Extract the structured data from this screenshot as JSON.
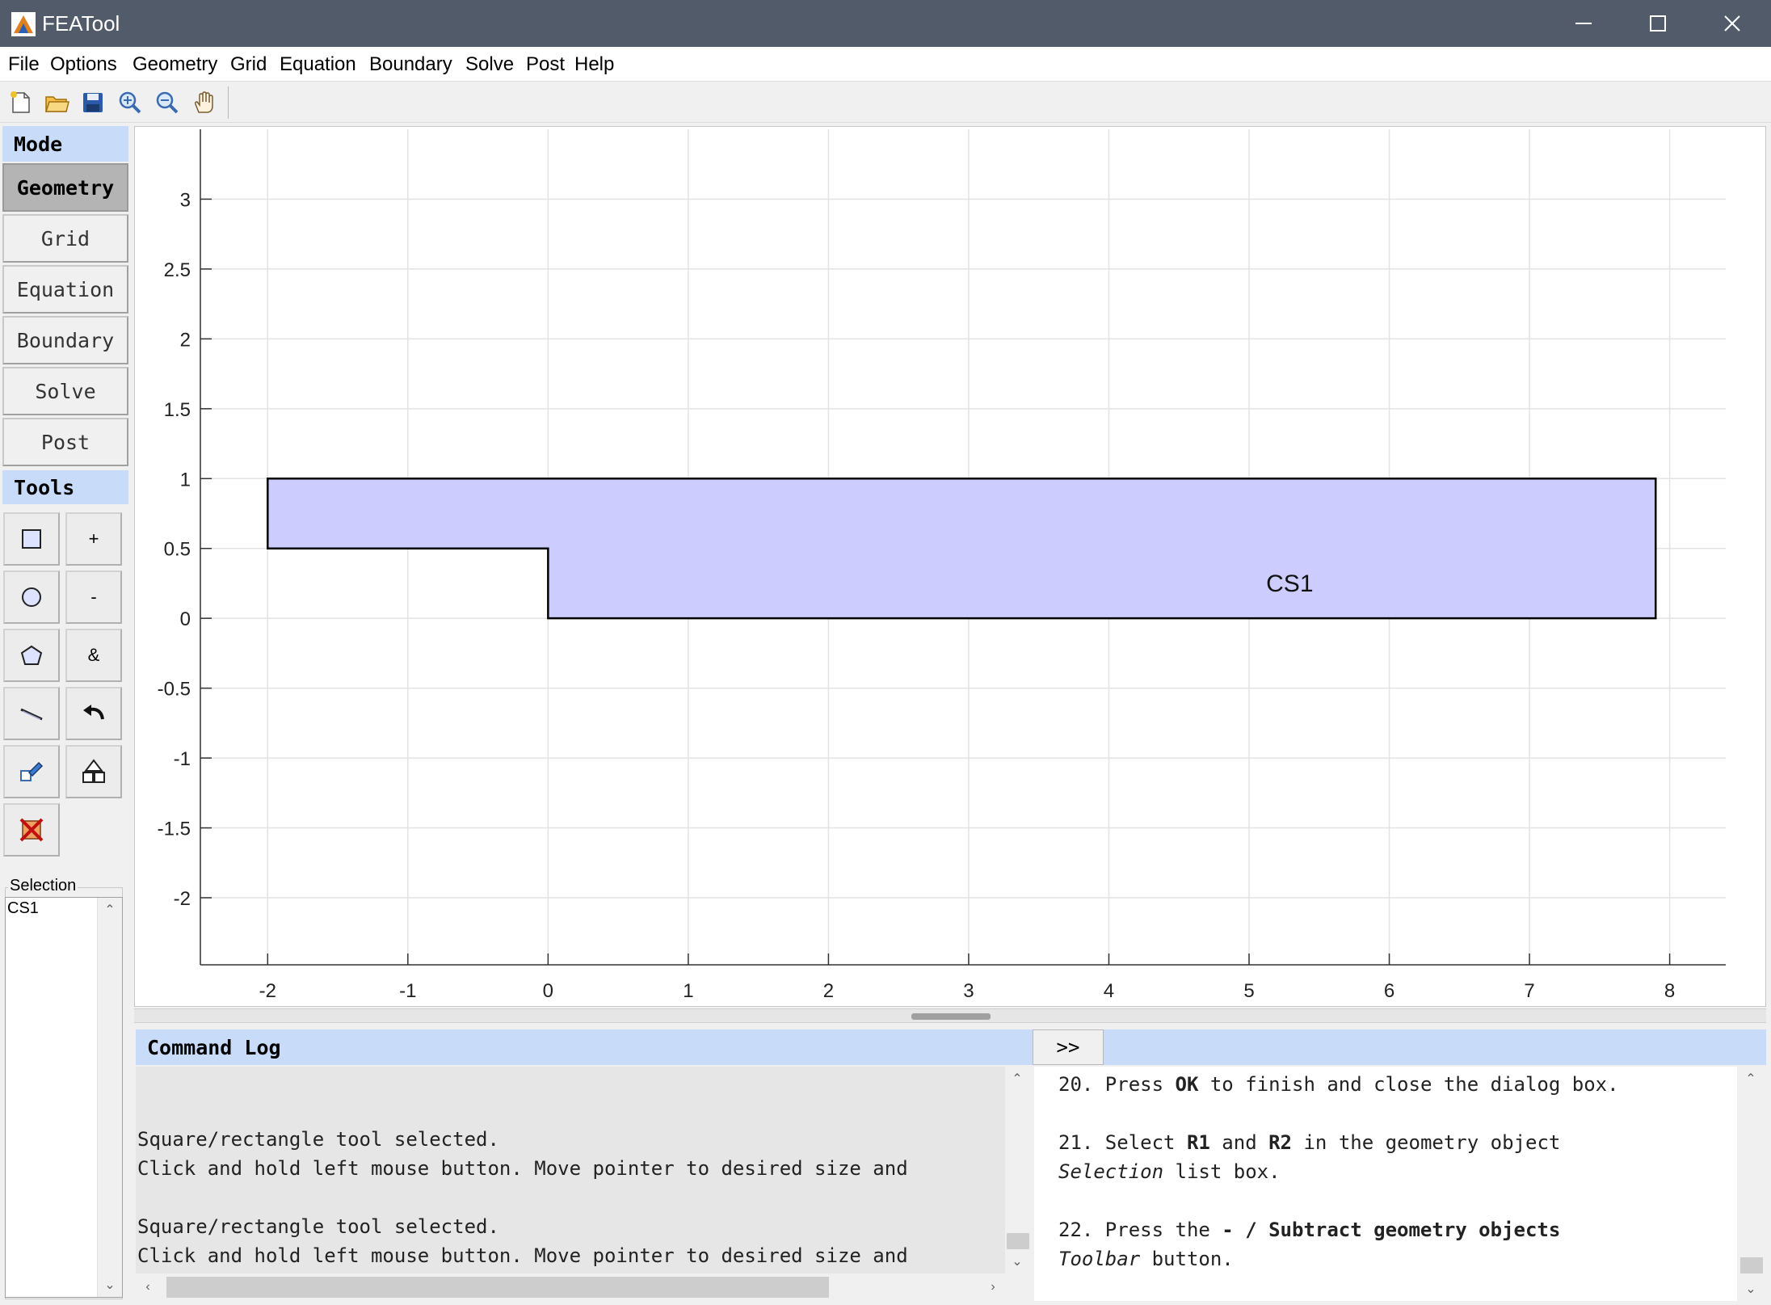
{
  "window": {
    "title": "FEATool",
    "controls": [
      "minimize",
      "maximize",
      "close"
    ]
  },
  "menu": [
    "File",
    "Options",
    "Geometry",
    "Grid",
    "Equation",
    "Boundary",
    "Solve",
    "Post",
    "Help"
  ],
  "toolbar": {
    "icons": [
      "new-file-icon",
      "open-folder-icon",
      "save-icon",
      "zoom-in-icon",
      "zoom-out-icon",
      "pan-hand-icon"
    ]
  },
  "left_panel": {
    "mode_header": "Mode",
    "modes": [
      "Geometry",
      "Grid",
      "Equation",
      "Boundary",
      "Solve",
      "Post"
    ],
    "active_mode": "Geometry",
    "tools_header": "Tools",
    "tools": {
      "plus": "+",
      "minus": "-",
      "intersect": "&"
    },
    "tool_icons": [
      "rectangle-icon",
      "plus-icon",
      "circle-icon",
      "minus-icon",
      "polygon-icon",
      "intersect-icon",
      "line-icon",
      "undo-icon",
      "edit-icon",
      "split-icon",
      "delete-all-icon"
    ],
    "selection_label": "Selection",
    "selection_items": [
      "CS1"
    ]
  },
  "plot": {
    "x_ticks": [
      "-2",
      "-1",
      "0",
      "1",
      "2",
      "3",
      "4",
      "5",
      "6",
      "7",
      "8"
    ],
    "y_ticks": [
      "3",
      "2.5",
      "2",
      "1.5",
      "1",
      "0.5",
      "0",
      "-0.5",
      "-1",
      "-1.5",
      "-2"
    ],
    "grid": true,
    "object_label": "CS1",
    "fill_color": "#ccccff",
    "edge_color": "#000000",
    "object_vertices": [
      [
        -2,
        1
      ],
      [
        7.9,
        1
      ],
      [
        7.9,
        0
      ],
      [
        0,
        0
      ],
      [
        0,
        0.5
      ],
      [
        -2,
        0.5
      ]
    ]
  },
  "command_log": {
    "header": "Command Log",
    "expand_label": ">>",
    "lines": [
      "",
      "",
      "Square/rectangle tool selected.",
      "Click and hold left mouse button. Move pointer to desired size and",
      "",
      "Square/rectangle tool selected.",
      "Click and hold left mouse button. Move pointer to desired size and"
    ]
  },
  "help": {
    "step20_num": "20. Press ",
    "step20_bold": "OK",
    "step20_rest": " to finish and close the dialog box.",
    "step21_num": "21. Select ",
    "step21_b1": "R1",
    "step21_and": " and ",
    "step21_b2": "R2",
    "step21_rest": " in the geometry object",
    "step21_italic": "Selection",
    "step21_tail": " list box.",
    "step22_num": "22. Press the ",
    "step22_bold": "- / Subtract geometry objects",
    "step22_italic": "Toolbar",
    "step22_tail": " button."
  }
}
